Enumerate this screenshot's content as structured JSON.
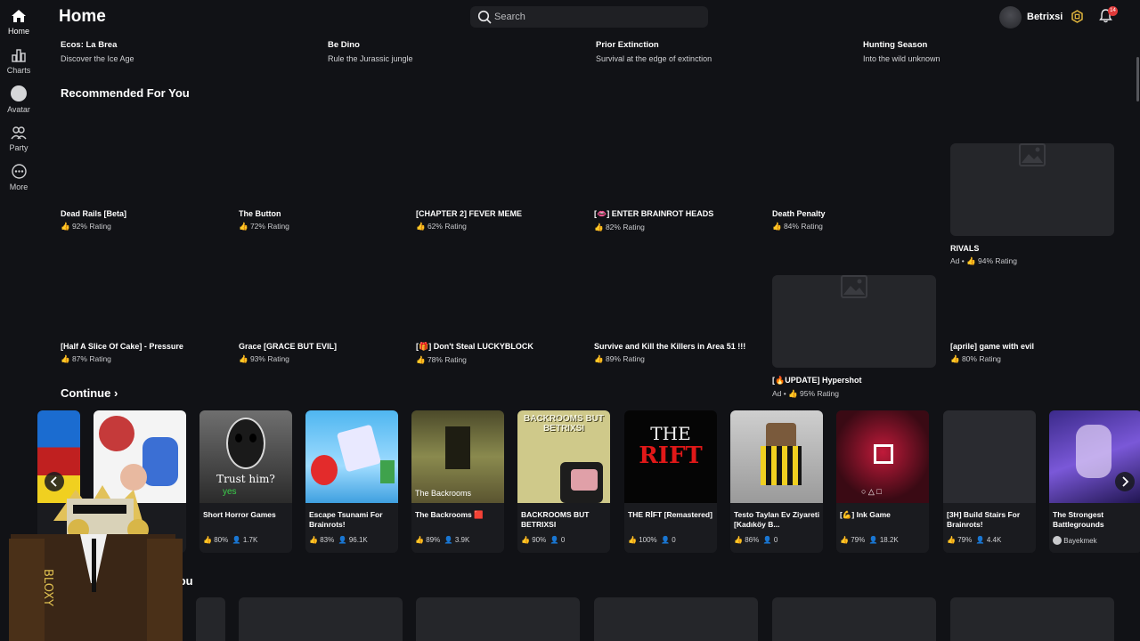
{
  "nav": [
    {
      "label": "Home",
      "icon": "home-icon"
    },
    {
      "label": "Charts",
      "icon": "charts-icon"
    },
    {
      "label": "Avatar",
      "icon": "avatar-icon"
    },
    {
      "label": "Party",
      "icon": "party-icon"
    },
    {
      "label": "More",
      "icon": "more-icon"
    }
  ],
  "header": {
    "title": "Home",
    "search_placeholder": "Search",
    "username": "Betrixsi",
    "notification_count": "14"
  },
  "featured": [
    {
      "title": "Ecos: La Brea",
      "subtitle": "Discover the Ice Age"
    },
    {
      "title": "Be Dino",
      "subtitle": "Rule the Jurassic jungle"
    },
    {
      "title": "Prior Extinction",
      "subtitle": "Survival at the edge of extinction"
    },
    {
      "title": "Hunting Season",
      "subtitle": "Into the wild unknown"
    }
  ],
  "recommended": {
    "title": "Recommended For You",
    "items": [
      {
        "title": "Dead Rails [Beta]",
        "rating": "92% Rating"
      },
      {
        "title": "The Button",
        "rating": "72% Rating"
      },
      {
        "title": "[CHAPTER 2] FEVER MEME",
        "rating": "62% Rating"
      },
      {
        "title": "[👄] ENTER BRAINROT HEADS",
        "rating": "82% Rating"
      },
      {
        "title": "Death Penalty",
        "rating": "84% Rating"
      },
      {
        "title": "RIVALS",
        "rating": "94% Rating",
        "ad": "Ad •"
      },
      {
        "title": "[Half A Slice Of Cake] - Pressure",
        "rating": "87% Rating"
      },
      {
        "title": "Grace [GRACE BUT EVIL]",
        "rating": "93% Rating"
      },
      {
        "title": "[🎁] Don't Steal LUCKYBLOCK",
        "rating": "78% Rating"
      },
      {
        "title": "Survive and Kill the Killers in Area 51 !!!",
        "rating": "89% Rating"
      },
      {
        "title": "[🔥UPDATE] Hypershot",
        "rating": "95% Rating",
        "ad": "Ad •"
      },
      {
        "title": "[aprile] game with evil",
        "rating": "80% Rating"
      }
    ]
  },
  "continue": {
    "title": "Continue",
    "items": [
      {
        "title": "Short Horror Games",
        "rating": "80%",
        "players": "1.7K",
        "thumb_text": "Trust him?",
        "thumb_text2": "yes"
      },
      {
        "title": "Escape Tsunami For Brainrots!",
        "rating": "83%",
        "players": "96.1K"
      },
      {
        "title": "The Backrooms 🟥",
        "rating": "89%",
        "players": "3.9K",
        "thumb_text": "The Backrooms"
      },
      {
        "title": "BACKROOMS BUT BETRIXSI",
        "rating": "90%",
        "players": "0",
        "thumb_text": "BACKROOMS BUT BETRIXSI"
      },
      {
        "title": "THE RİFT [Remastered]",
        "rating": "100%",
        "players": "0",
        "thumb_text": "THE RIFT"
      },
      {
        "title": "Testo Taylan Ev Ziyareti [Kadıköy B...",
        "rating": "86%",
        "players": "0"
      },
      {
        "title": "[💪] Ink Game",
        "rating": "79%",
        "players": "18.2K"
      },
      {
        "title": "[3H] Build Stairs For Brainrots!",
        "rating": "79%",
        "players": "4.4K"
      },
      {
        "title": "The Strongest Battlegrounds",
        "creator": "Bayekmek"
      }
    ]
  },
  "bottom_section": {
    "title_fragment": "You"
  },
  "colors": {
    "background": "#111216",
    "card": "#1a1b1f",
    "placeholder": "#25262a",
    "badge": "#e03a3a"
  }
}
